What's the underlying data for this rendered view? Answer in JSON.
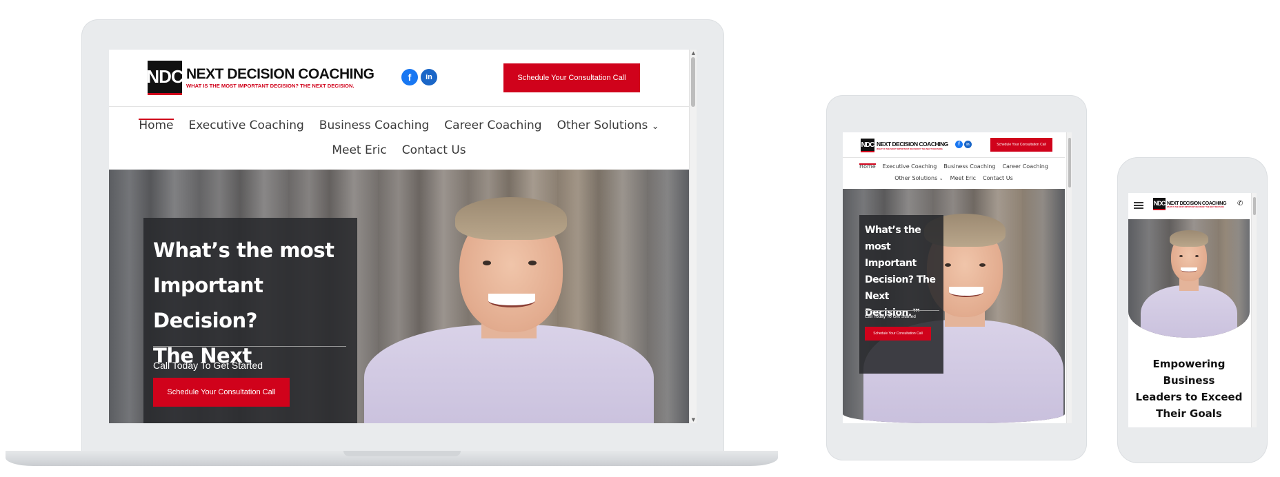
{
  "site": {
    "logo_mark": "NDC",
    "logo_name": "NEXT DECISION COACHING",
    "logo_tagline": "WHAT IS THE MOST IMPORTANT DECISION? THE NEXT DECISION.",
    "social": {
      "facebook": "f",
      "linkedin": "in"
    },
    "cta_label": "Schedule Your Consultation Call",
    "nav": {
      "home": "Home",
      "executive": "Executive Coaching",
      "business": "Business Coaching",
      "career": "Career Coaching",
      "other": "Other Solutions",
      "other_chevron": "⌄",
      "meet": "Meet Eric",
      "contact": "Contact Us"
    },
    "hero": {
      "line1": "What’s the most",
      "line2": "Important Decision?",
      "line3": "The Next Decision.™",
      "sub": "Call Today To Get Started",
      "cta": "Schedule Your Consultation Call"
    },
    "tablet_hero_lines": [
      "What’s the most",
      "Important",
      "Decision? The",
      "Next",
      "Decision.™"
    ],
    "mobile_tagline_lines": [
      "Empowering Business",
      "Leaders to Exceed",
      "Their Goals"
    ],
    "mobile_icons": {
      "menu": "≡",
      "phone": "✆"
    },
    "scroll_up": "▲",
    "scroll_down": "▼"
  },
  "colors": {
    "brand_red": "#d0021b",
    "facebook_blue": "#1877f2",
    "linkedin_blue": "#1a66c7",
    "frame_gray": "#e9ebed"
  }
}
